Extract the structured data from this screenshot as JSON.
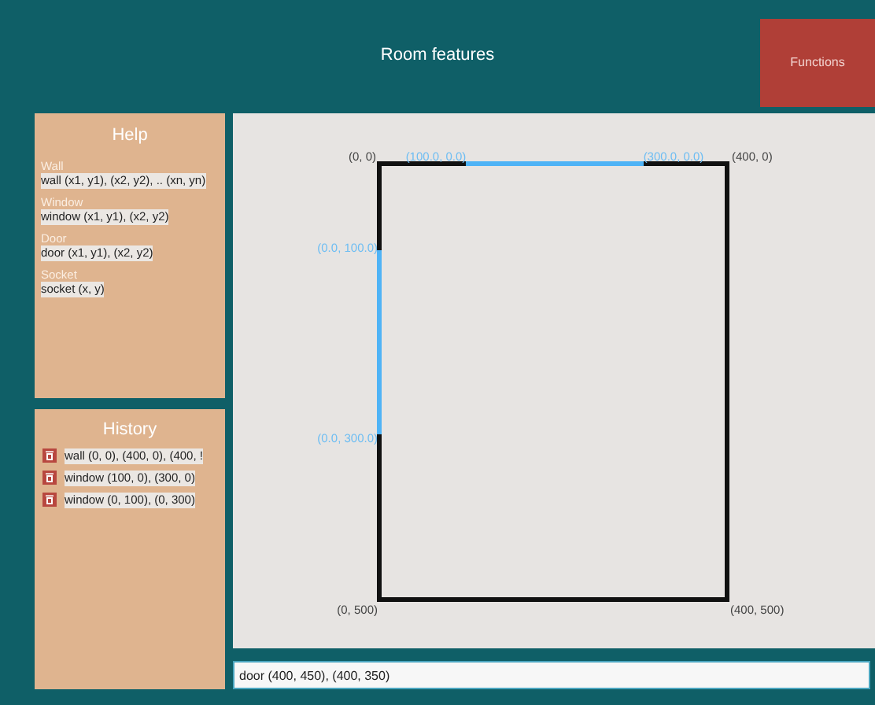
{
  "header": {
    "title": "Room features",
    "functions_button": "Functions"
  },
  "help": {
    "title": "Help",
    "entries": [
      {
        "name": "Wall",
        "syntax": "wall (x1, y1), (x2, y2), .. (xn, yn)"
      },
      {
        "name": "Window",
        "syntax": "window (x1, y1), (x2, y2)"
      },
      {
        "name": "Door",
        "syntax": "door (x1, y1), (x2, y2)"
      },
      {
        "name": "Socket",
        "syntax": "socket (x, y)"
      }
    ]
  },
  "history": {
    "title": "History",
    "items": [
      "wall (0, 0), (400, 0), (400, !",
      "window (100, 0), (300, 0)",
      "window (0, 100), (0, 300)"
    ]
  },
  "plan": {
    "labels": [
      {
        "kind": "corner",
        "text": "(0, 0)"
      },
      {
        "kind": "window",
        "text": "(100.0, 0.0)"
      },
      {
        "kind": "window",
        "text": "(300.0, 0.0)"
      },
      {
        "kind": "corner",
        "text": "(400, 0)"
      },
      {
        "kind": "window",
        "text": "(0.0, 100.0)"
      },
      {
        "kind": "window",
        "text": "(0.0, 300.0)"
      },
      {
        "kind": "corner",
        "text": "(0, 500)"
      },
      {
        "kind": "corner",
        "text": "(400, 500)"
      }
    ]
  },
  "command": {
    "value": "door (400, 450), (400, 350)"
  }
}
